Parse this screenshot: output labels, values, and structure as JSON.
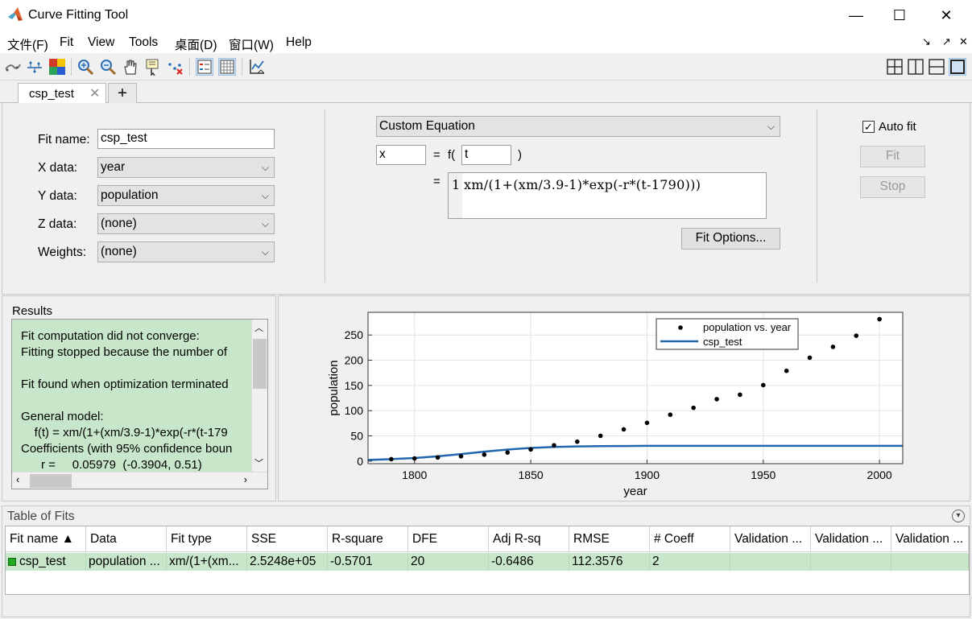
{
  "window": {
    "title": "Curve Fitting Tool",
    "minimize": "—",
    "maximize": "☐",
    "close": "✕"
  },
  "menu": {
    "items": [
      "文件(F)",
      "Fit",
      "View",
      "Tools",
      "桌面(D)",
      "窗口(W)",
      "Help"
    ],
    "right_controls": [
      "↘",
      "↗",
      "✕"
    ]
  },
  "toolbar": {
    "icons": [
      "fit-plot-icon",
      "residuals-plot-icon",
      "surface-colormap-icon",
      "zoom-in-icon",
      "zoom-out-icon",
      "pan-hand-icon",
      "data-cursor-icon",
      "exclude-outliers-icon",
      "legend-icon",
      "grid-icon",
      "axes-limits-icon"
    ],
    "layout_icons": [
      "tile-quad-icon",
      "tile-vertical-icon",
      "tile-horizontal-icon",
      "single-panel-icon"
    ]
  },
  "tabs": [
    {
      "label": "csp_test",
      "close": "✕"
    }
  ],
  "tab_add": "+",
  "setup": {
    "fit_name_label": "Fit name:",
    "fit_name_value": "csp_test",
    "x_data_label": "X data:",
    "x_data_value": "year",
    "y_data_label": "Y data:",
    "y_data_value": "population",
    "z_data_label": "Z data:",
    "z_data_value": "(none)",
    "weights_label": "Weights:",
    "weights_value": "(none)",
    "fit_type": "Custom Equation",
    "dependent_var": "x",
    "equals": "=",
    "f_open": "f(",
    "independent_var": "t",
    "f_close": ")",
    "equation_equals": "=",
    "equation_line_no": "1",
    "equation": "xm/(1+(xm/3.9-1)*exp(-r*(t-1790)))",
    "fit_options_button": "Fit Options...",
    "auto_fit_label": "Auto fit",
    "auto_fit_checked": true,
    "fit_button": "Fit",
    "stop_button": "Stop"
  },
  "results": {
    "header": "Results",
    "lines": [
      "Fit computation did not converge:",
      "Fitting stopped because the number of",
      "",
      "Fit found when optimization terminated",
      "",
      "General model:",
      "    f(t) = xm/(1+(xm/3.9-1)*exp(-r*(t-179",
      "Coefficients (with 95% confidence boun",
      "      r =     0.05979  (-0.3904, 0.51)"
    ]
  },
  "chart_data": {
    "type": "scatter",
    "xlabel": "year",
    "ylabel": "population",
    "xlim": [
      1780,
      2010
    ],
    "ylim": [
      -5,
      295
    ],
    "xticks": [
      1800,
      1850,
      1900,
      1950,
      2000
    ],
    "yticks": [
      0,
      50,
      100,
      150,
      200,
      250
    ],
    "grid": true,
    "legend_position": "top-right",
    "series": [
      {
        "name": "population vs. year",
        "kind": "scatter",
        "color": "#000000",
        "x": [
          1790,
          1800,
          1810,
          1820,
          1830,
          1840,
          1850,
          1860,
          1870,
          1880,
          1890,
          1900,
          1910,
          1920,
          1930,
          1940,
          1950,
          1960,
          1970,
          1980,
          1990,
          2000
        ],
        "y": [
          3.9,
          5.3,
          7.2,
          9.6,
          12.9,
          17.1,
          23.1,
          31.4,
          38.6,
          50.2,
          62.9,
          76.0,
          92.0,
          105.7,
          122.8,
          131.7,
          150.7,
          179.0,
          205.0,
          226.5,
          248.7,
          281.4
        ]
      },
      {
        "name": "csp_test",
        "kind": "line",
        "color": "#2166ac",
        "x": [
          1780,
          1790,
          1800,
          1810,
          1820,
          1830,
          1840,
          1850,
          1860,
          1870,
          1880,
          1890,
          1900,
          1920,
          1950,
          1980,
          2010
        ],
        "y": [
          2.4,
          3.9,
          6.2,
          9.6,
          14.0,
          18.8,
          23.0,
          26.1,
          28.0,
          29.1,
          29.7,
          30.0,
          30.2,
          30.3,
          30.3,
          30.3,
          30.3
        ]
      }
    ]
  },
  "table_of_fits": {
    "header": "Table of Fits",
    "collapse_icon": "▾",
    "columns": [
      "Fit name ▲",
      "Data",
      "Fit type",
      "SSE",
      "R-square",
      "DFE",
      "Adj R-sq",
      "RMSE",
      "# Coeff",
      "Validation ...",
      "Validation ...",
      "Validation ..."
    ],
    "rows": [
      [
        "csp_test",
        "population ...",
        "xm/(1+(xm...",
        "2.5248e+05",
        "-0.5701",
        "20",
        "-0.6486",
        "112.3576",
        "2",
        "",
        "",
        ""
      ]
    ],
    "row_status_color": "#22a822"
  },
  "colors": {
    "results_bg": "#c8e6c9",
    "line": "#2166ac",
    "window_bg": "#f0f0f0"
  }
}
